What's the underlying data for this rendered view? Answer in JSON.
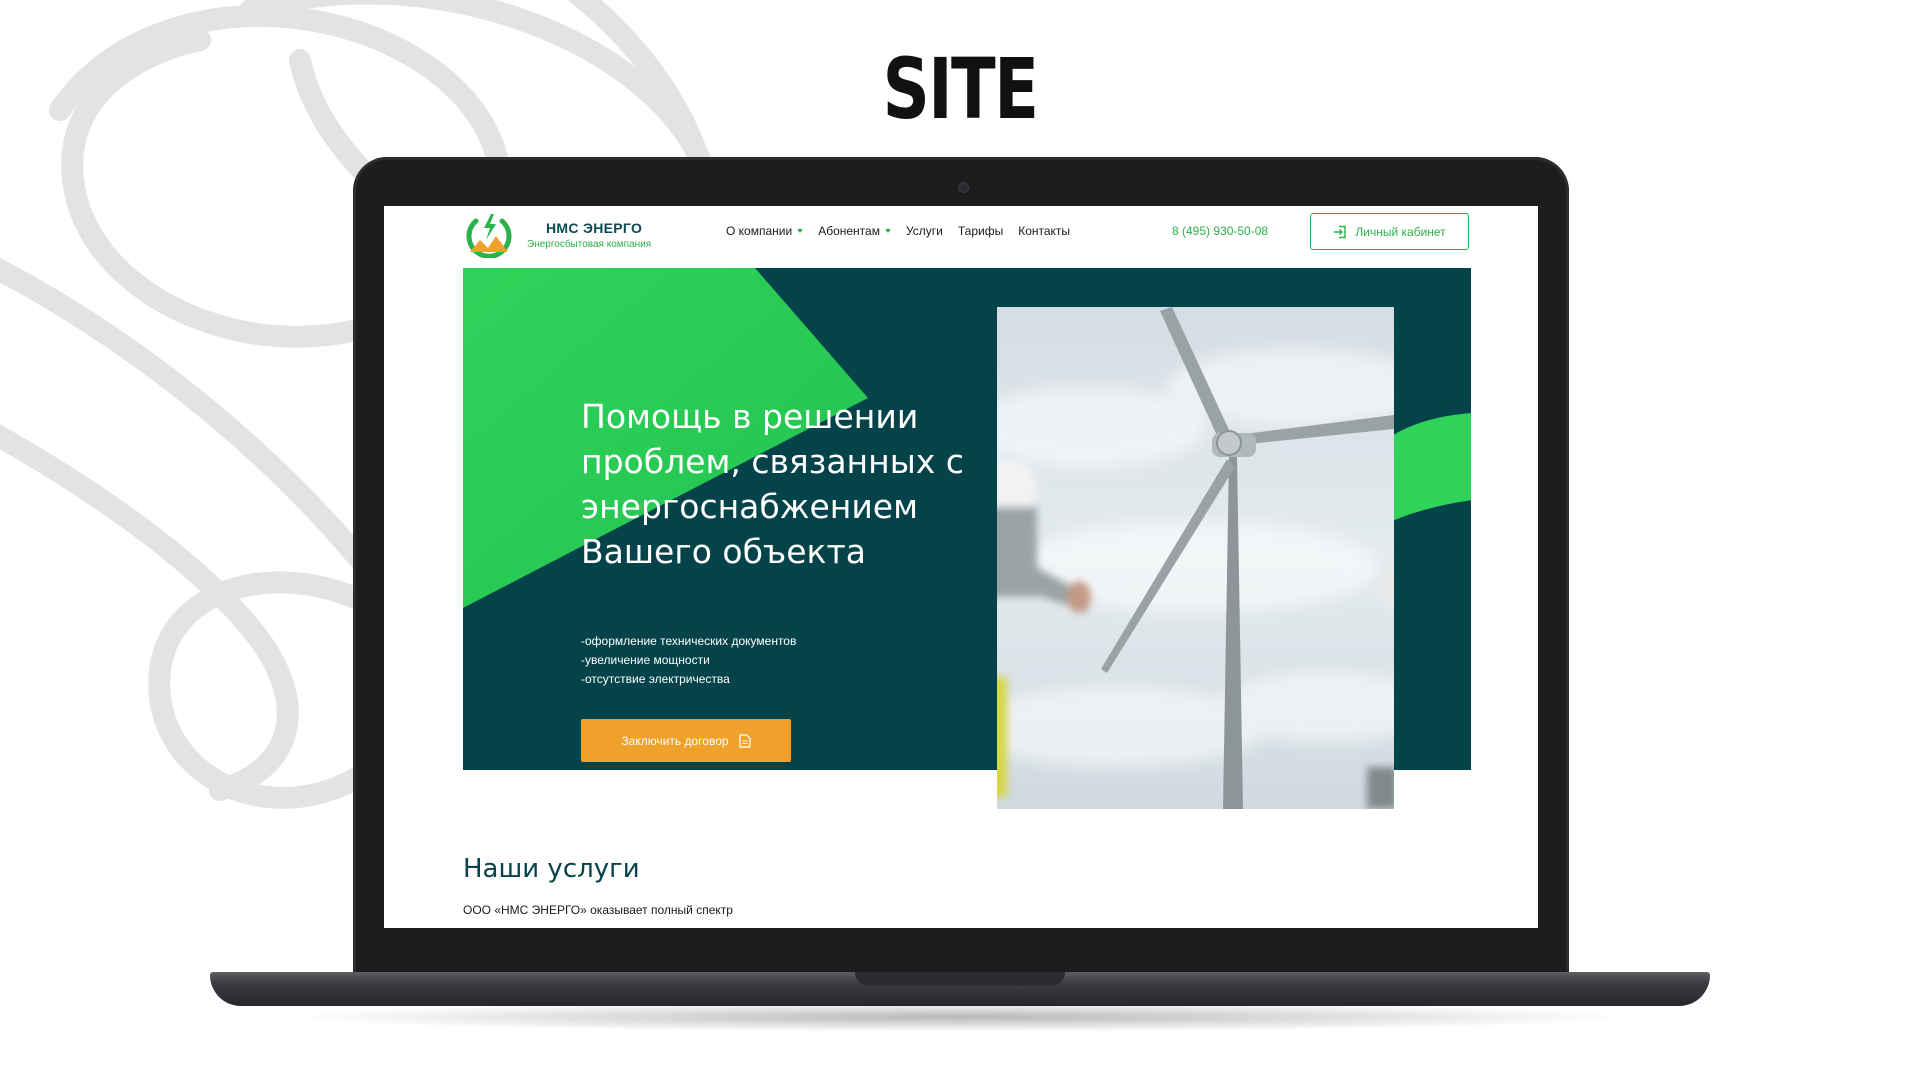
{
  "title": "SITE",
  "site": {
    "brand": {
      "name": "НМС ЭНЕРГО",
      "tagline": "Энергосбытовая компания"
    },
    "nav": [
      {
        "label": "О компании",
        "dropdown": true
      },
      {
        "label": "Абонентам",
        "dropdown": true
      },
      {
        "label": "Услуги",
        "dropdown": false
      },
      {
        "label": "Тарифы",
        "dropdown": false
      },
      {
        "label": "Контакты",
        "dropdown": false
      }
    ],
    "phone": "8 (495) 930-50-08",
    "cabinet_button": "Личный кабинет",
    "hero": {
      "title": "Помощь в решении проблем, связанных с энергоснабжением Вашего объекта",
      "bullets": [
        "-оформление технических документов",
        "-увеличение мощности",
        "-отсутствие электричества"
      ],
      "cta": "Заключить договор"
    },
    "services": {
      "title": "Наши услуги",
      "text": "ООО «НМС ЭНЕРГО» оказывает полный спектр"
    }
  },
  "icons": {
    "logo": "power-lightning-logo",
    "cabinet": "login-icon",
    "cta": "document-icon",
    "caret": "chevron-down-icon"
  },
  "colors": {
    "dark_teal": "#05434a",
    "green": "#2bb24c",
    "bright_green": "#2fd35a",
    "orange": "#f0a12b"
  }
}
